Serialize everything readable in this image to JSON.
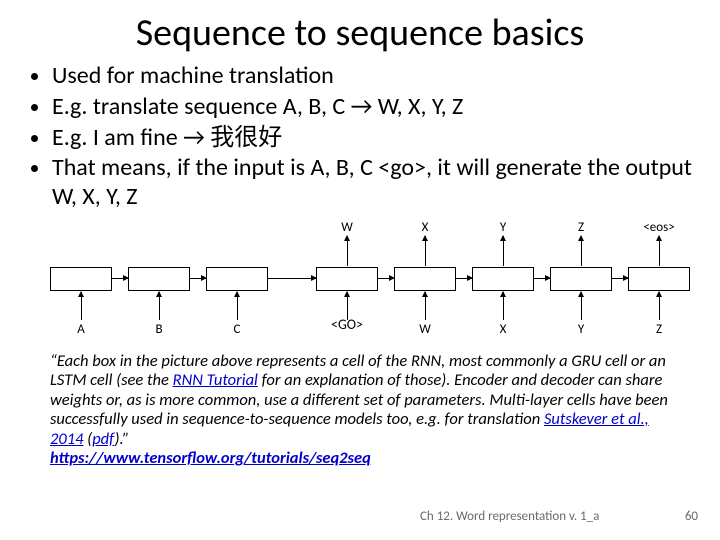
{
  "title": "Sequence to sequence basics",
  "bullets": [
    "Used for machine translation",
    "E.g. translate sequence A, B, C → W, X, Y, Z",
    "E.g. I am fine → 我很好",
    "That means, if the input is A, B, C <go>, it will generate the output W, X, Y, Z"
  ],
  "diagram": {
    "encoder_inputs": [
      "A",
      "B",
      "C"
    ],
    "decoder_inputs": [
      "<GO>",
      "W",
      "X",
      "Y",
      "Z"
    ],
    "decoder_outputs": [
      "W",
      "X",
      "Y",
      "Z",
      "<eos>"
    ]
  },
  "quote_parts": {
    "p1": "“Each box in the picture above represents a cell of the RNN, most commonly a GRU cell or an LSTM cell (see the ",
    "link1": "RNN Tutorial",
    "p2": " for an explanation of those). Encoder and decoder can share weights or, as is more common, use a different set of parameters. Multi-layer cells have been successfully used in sequence-to-sequence models too, e.g. for translation ",
    "link2": "Sutskever et al., 2014",
    "p3": " (",
    "link3": "pdf",
    "p4": ").”",
    "src": "https://www.tensorflow.org/tutorials/seq2seq"
  },
  "footer": {
    "chapter": "Ch 12.  Word  representation v. 1_a",
    "page": "60"
  }
}
